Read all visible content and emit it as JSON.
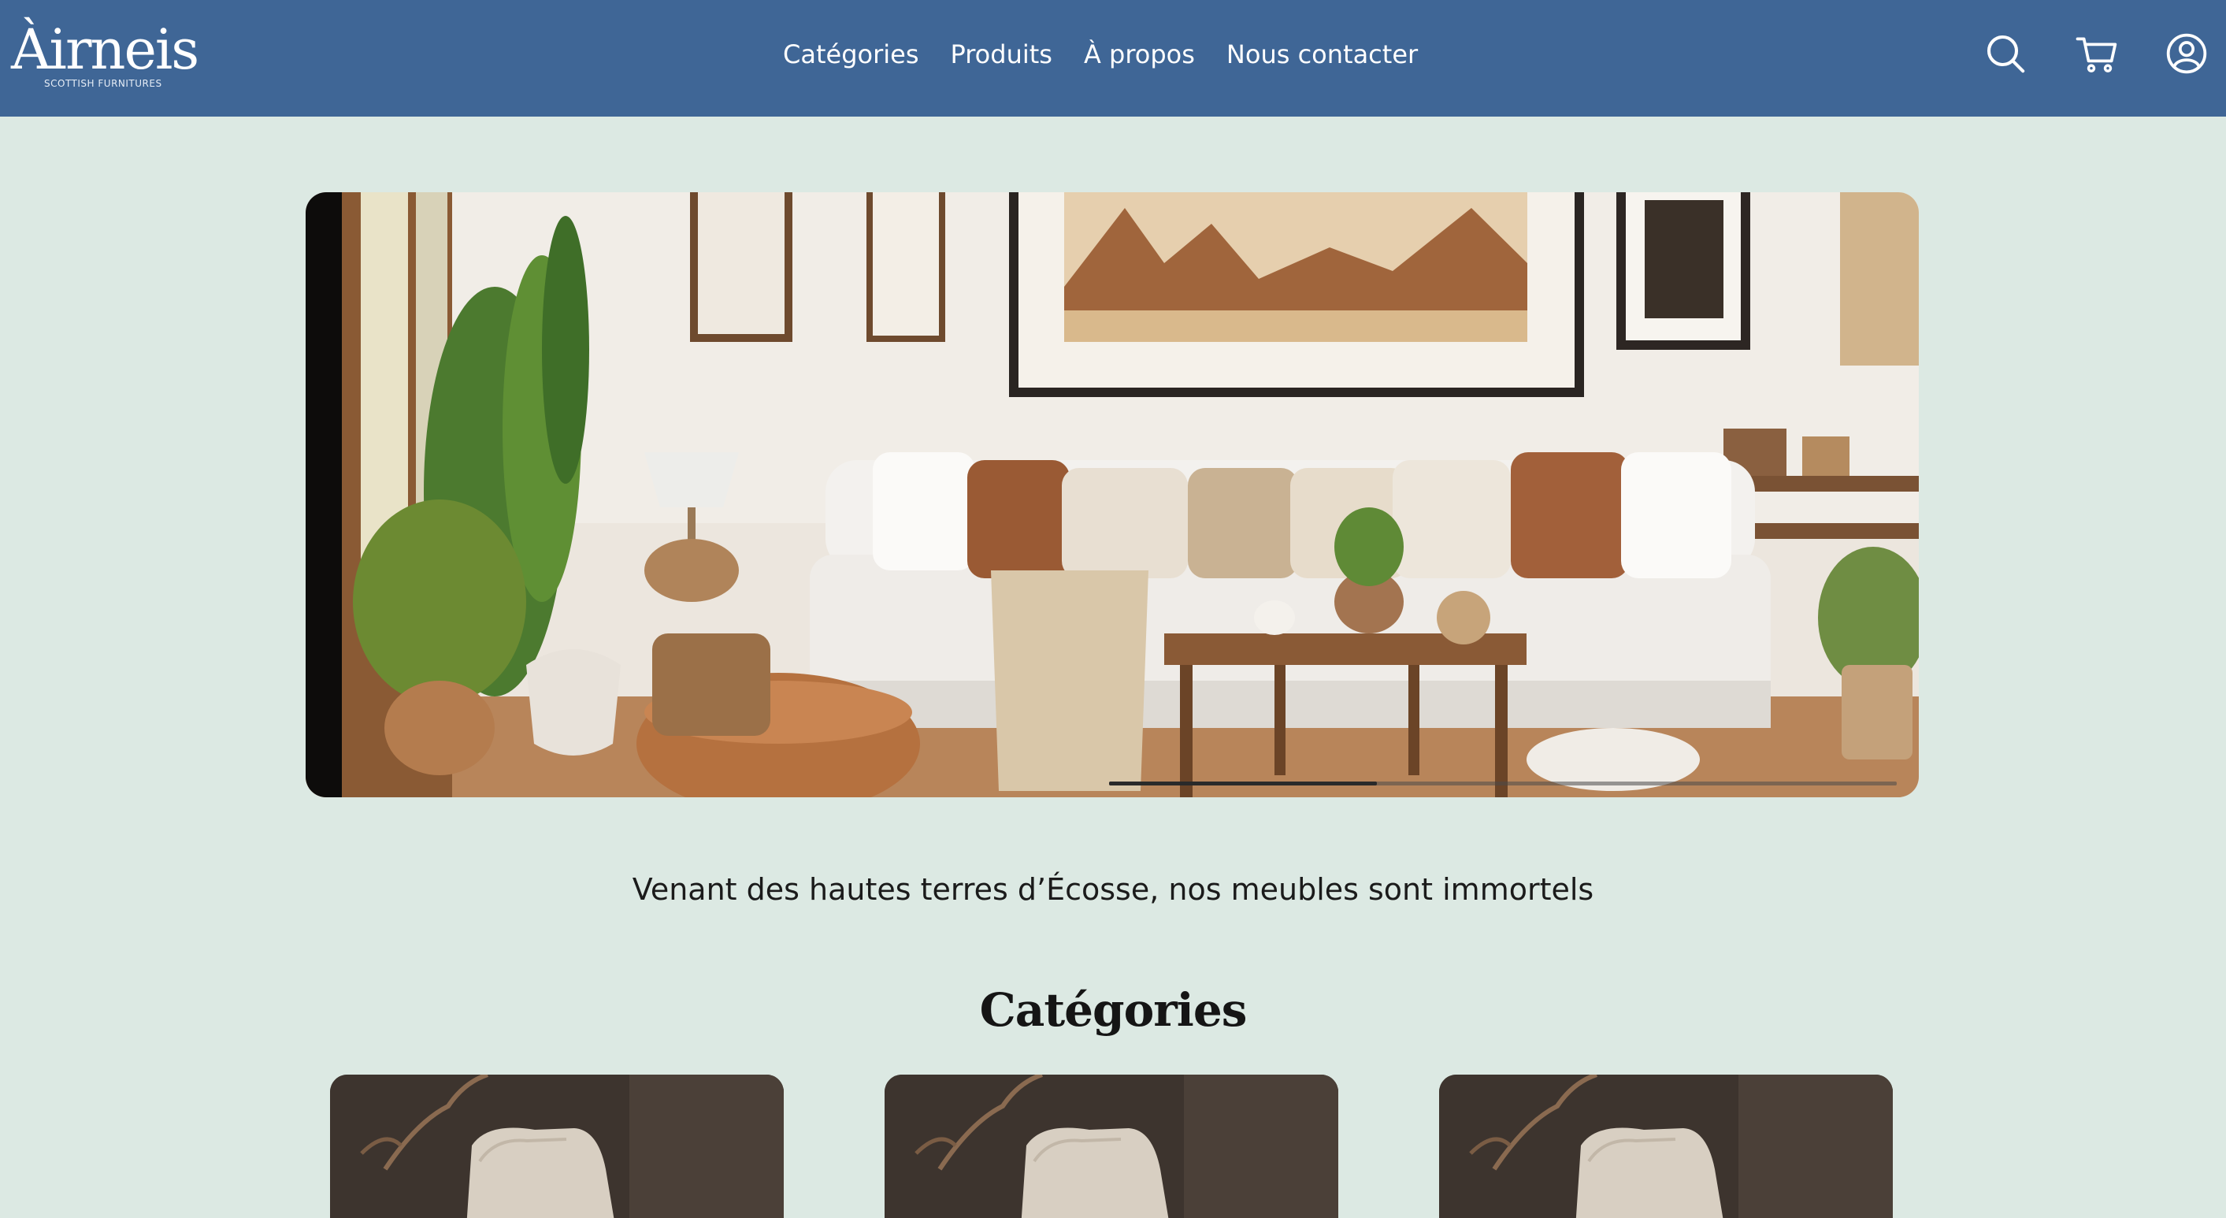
{
  "header": {
    "logo_text": "Àirneis",
    "logo_tagline": "SCOTTISH FURNITURES",
    "nav": [
      {
        "label": "Catégories"
      },
      {
        "label": "Produits"
      },
      {
        "label": "À propos"
      },
      {
        "label": "Nous contacter"
      }
    ],
    "icons": {
      "search": "search-icon",
      "cart": "cart-icon",
      "account": "user-icon"
    },
    "background_color": "#3f6696"
  },
  "hero": {
    "image": "living-room-photo",
    "carousel_slides": 3,
    "active_slide": 1
  },
  "tagline": "Venant des hautes terres d’Écosse, nos meubles sont immortels",
  "categories": {
    "title": "Catégories",
    "cards": [
      {
        "image": "armchair-photo"
      },
      {
        "image": "armchair-photo"
      },
      {
        "image": "armchair-photo"
      }
    ]
  },
  "page": {
    "background_color": "#dce9e3"
  }
}
